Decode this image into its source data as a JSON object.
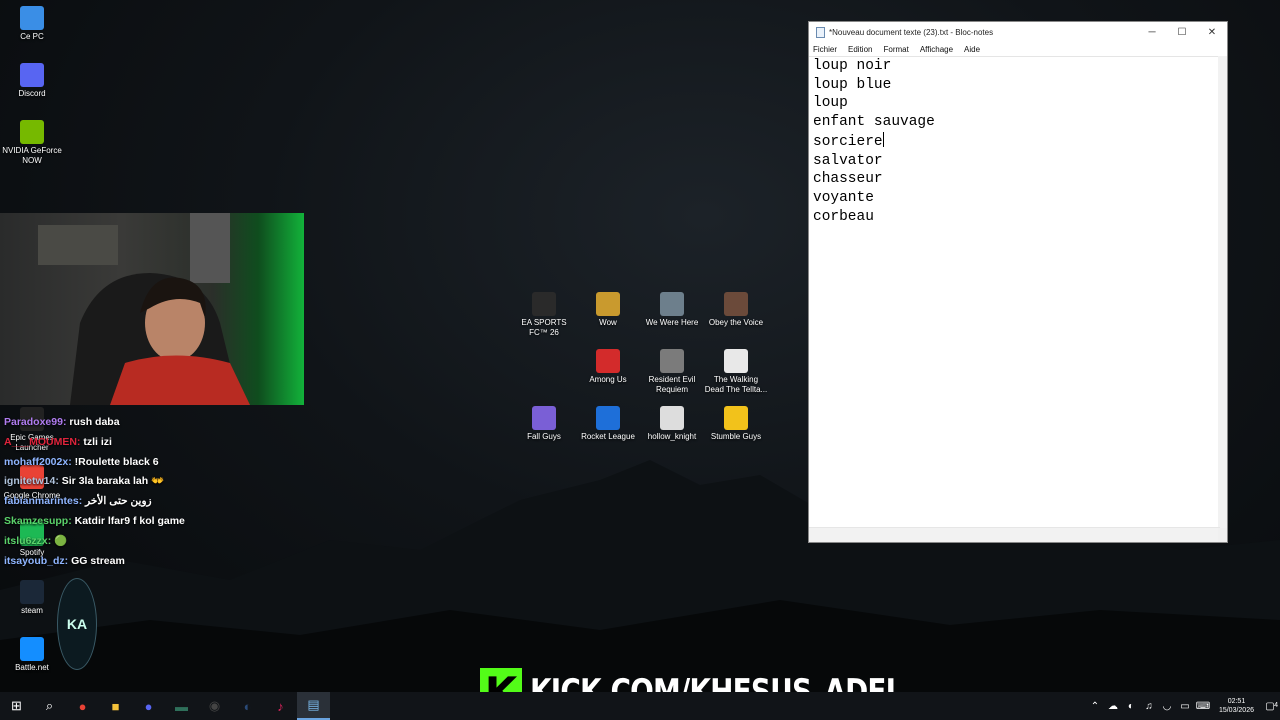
{
  "desktop_left_icons": [
    {
      "label": "Ce PC",
      "icon": "computer-icon",
      "color": "#3a8ee6"
    },
    {
      "label": "Discord",
      "icon": "discord-icon",
      "color": "#5865f2"
    },
    {
      "label": "NVIDIA GeForce NOW",
      "icon": "nvidia-icon",
      "color": "#76b900"
    },
    {
      "label": "Epic Games Launcher",
      "icon": "epic-icon",
      "color": "#222222"
    },
    {
      "label": "Google Chrome",
      "icon": "chrome-icon",
      "color": "#e94235"
    },
    {
      "label": "Spotify",
      "icon": "spotify-icon",
      "color": "#1db954"
    },
    {
      "label": "steam",
      "icon": "steam-icon",
      "color": "#1b2838"
    },
    {
      "label": "Battle.net",
      "icon": "battlenet-icon",
      "color": "#148eff"
    }
  ],
  "desktop_grid_icons": [
    {
      "label": "EA SPORTS FC™ 26",
      "icon": "ea-fc-icon",
      "color": "#2a2a2a"
    },
    {
      "label": "Wow",
      "icon": "wow-icon",
      "color": "#c99a2e"
    },
    {
      "label": "We Were Here",
      "icon": "we-were-here-icon",
      "color": "#6d7f8c"
    },
    {
      "label": "Obey the Voice",
      "icon": "obey-the-voice-icon",
      "color": "#6b4a3a"
    },
    {
      "label": "Among Us",
      "icon": "among-us-icon",
      "color": "#d32b2b"
    },
    {
      "label": "Resident Evil Requiem",
      "icon": "resident-evil-icon",
      "color": "#7b7b7b"
    },
    {
      "label": "The Walking Dead The Tellta...",
      "icon": "walking-dead-icon",
      "color": "#e8e8e8"
    },
    {
      "label": "Fall Guys",
      "icon": "fall-guys-icon",
      "color": "#7a5fd6"
    },
    {
      "label": "Rocket League",
      "icon": "rocket-league-icon",
      "color": "#1e6fd9"
    },
    {
      "label": "hollow_knight",
      "icon": "hollow-knight-icon",
      "color": "#dddddd"
    },
    {
      "label": "Stumble Guys",
      "icon": "stumble-guys-icon",
      "color": "#f2c21b"
    }
  ],
  "chat": [
    {
      "user": "Paradoxe99:",
      "message": "rush daba",
      "color": "#b07cf0"
    },
    {
      "user": "A___MOUMEN:",
      "message": "tzli izi",
      "color": "#e0243c"
    },
    {
      "user": "mohaff2002x:",
      "message": "!Roulette black 6",
      "color": "#8fb5ff"
    },
    {
      "user": "ignitetw14:",
      "message": "Sir 3la baraka lah 👐",
      "color": "#b0c4de"
    },
    {
      "user": "fabianmarintes:",
      "message": "زوين حتى الأخر",
      "color": "#8fb5ff"
    },
    {
      "user": "Skamzesupp:",
      "message": "Katdir lfar9 f kol game",
      "color": "#5bd36b"
    },
    {
      "user": "itslu6zzx:",
      "message": "🟢",
      "color": "#5bd36b"
    },
    {
      "user": "itsayoub_dz:",
      "message": "GG stream",
      "color": "#8fb5ff"
    }
  ],
  "notepad": {
    "title": "*Nouveau document texte (23).txt - Bloc-notes",
    "menu": [
      "Fichier",
      "Edition",
      "Format",
      "Affichage",
      "Aide"
    ],
    "lines": [
      "loup noir",
      "loup blue",
      "loup",
      "enfant sauvage",
      "sorciere",
      "salvator",
      "chasseur",
      "voyante",
      "corbeau"
    ],
    "caret_line": 4
  },
  "overlay": {
    "kick_letter": "K",
    "kick_url": "KICK.COM/KHESUS_ADEL",
    "kick_color": "#53fc18"
  },
  "taskbar": {
    "apps": [
      {
        "name": "start-icon",
        "glyph": "⊞",
        "color": "#ffffff"
      },
      {
        "name": "search-icon",
        "glyph": "⌕",
        "color": "#ffffff"
      },
      {
        "name": "chrome-icon",
        "glyph": "●",
        "color": "#e94235"
      },
      {
        "name": "file-explorer-icon",
        "glyph": "■",
        "color": "#f3c13a"
      },
      {
        "name": "discord-icon",
        "glyph": "●",
        "color": "#5865f2"
      },
      {
        "name": "terminal-icon",
        "glyph": "▬",
        "color": "#2f6f5a"
      },
      {
        "name": "obs-icon",
        "glyph": "◉",
        "color": "#444444"
      },
      {
        "name": "steam-icon",
        "glyph": "◐",
        "color": "#2a4a78"
      },
      {
        "name": "tiktok-icon",
        "glyph": "♪",
        "color": "#e0245e"
      },
      {
        "name": "notepad-icon",
        "glyph": "▤",
        "color": "#7ab8e8"
      }
    ],
    "tray_icons": [
      "chevron-up-icon",
      "network-icon",
      "steam-tray-icon",
      "volume-icon",
      "wifi-icon",
      "battery-icon",
      "keyboard-icon"
    ],
    "time": "02:51",
    "date": "15/03/2026",
    "notification_count": "4"
  }
}
